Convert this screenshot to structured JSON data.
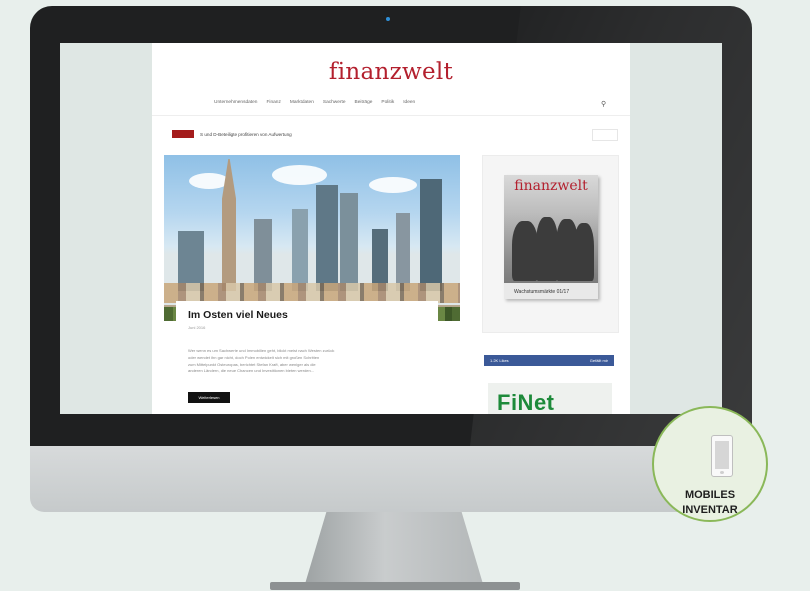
{
  "site": {
    "logo": "finanzwelt",
    "nav": [
      "Unternehmensdaten",
      "Finanz",
      "Marktdaten",
      "Sachwerte",
      "Beiträge",
      "Politik",
      "Ideen"
    ],
    "ticker": "S und D-Beteiligte profitieren von Aufwertung",
    "article": {
      "title": "Im Osten viel Neues",
      "date": "Juni 2016",
      "excerpt": [
        "Wer wenn es um Sachwerte und Immobilien geht, blickt meist nach Westen zurück",
        "oder wendet ihn gar nicht, doch Polen entwickelt sich mit großen Schritten",
        "zum Mittelpunkt Osteuropas, berichtet Stefan Kraft, aber weniger als die",
        "anderen Ländern, die neue Chancen und Investitionen bieten werden..."
      ],
      "button": "Weiterlesen"
    },
    "magazine": {
      "logo": "finanzwelt",
      "caption": "Wachstumsmärkte 01/17"
    },
    "facebook": {
      "left": "1.2K Likes",
      "right": "Gefällt mir"
    },
    "finet": "FiNet"
  },
  "badge": {
    "line1": "MOBILES",
    "line2": "INVENTAR"
  },
  "colors": {
    "brand_red": "#b3202e",
    "badge_green": "#8ab859",
    "facebook_blue": "#3b5998",
    "finet_green": "#1d8a3a"
  }
}
